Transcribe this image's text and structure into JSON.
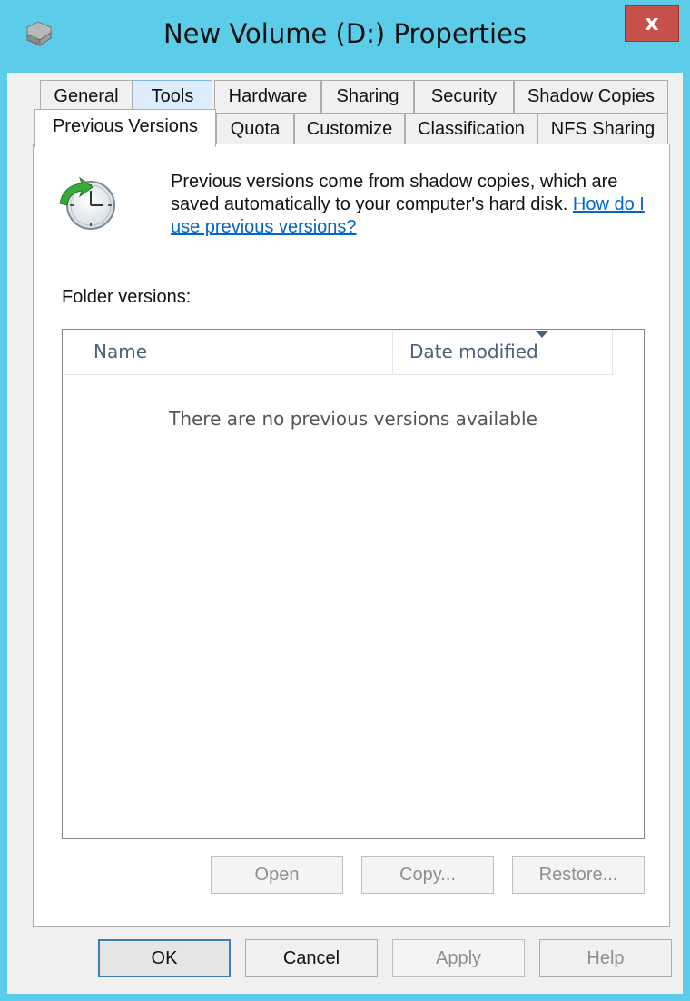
{
  "window": {
    "title": "New Volume (D:) Properties",
    "close_label": "x"
  },
  "tabs": {
    "row1": [
      "General",
      "Tools",
      "Hardware",
      "Sharing",
      "Security",
      "Shadow Copies"
    ],
    "row2": [
      "Previous Versions",
      "Quota",
      "Customize",
      "Classification",
      "NFS Sharing"
    ],
    "selected": "Previous Versions"
  },
  "intro": {
    "text": "Previous versions come from shadow copies, which are saved automatically to your computer's hard disk. ",
    "link": "How do I use previous versions?"
  },
  "folder_versions": {
    "label": "Folder versions:",
    "columns": [
      "Name",
      "Date modified"
    ],
    "empty_message": "There are no previous versions available"
  },
  "actions": {
    "open": "Open",
    "copy": "Copy...",
    "restore": "Restore..."
  },
  "dialog_buttons": {
    "ok": "OK",
    "cancel": "Cancel",
    "apply": "Apply",
    "help": "Help"
  },
  "colors": {
    "titlebar": "#5ccde9",
    "close": "#c7504b",
    "link": "#0066cc"
  }
}
